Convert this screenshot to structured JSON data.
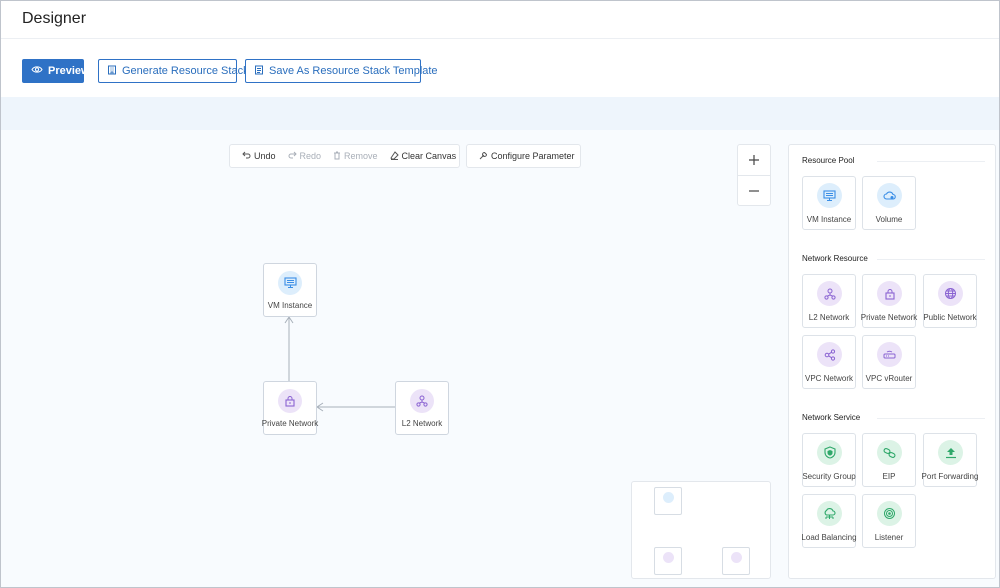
{
  "header": {
    "title": "Designer"
  },
  "actions": {
    "preview": "Preview",
    "generate": "Generate Resource Stack",
    "save_template": "Save As Resource Stack Template"
  },
  "toolbar": {
    "undo": "Undo",
    "redo": "Redo",
    "remove": "Remove",
    "clear_canvas": "Clear Canvas",
    "configure_parameter": "Configure Parameter"
  },
  "zoom": {
    "zoom_in": "+",
    "zoom_out": "−"
  },
  "canvas_nodes": [
    {
      "label": "VM Instance",
      "icon": "vm-instance-icon",
      "color": "blue"
    },
    {
      "label": "Private Network",
      "icon": "private-network-icon",
      "color": "purple"
    },
    {
      "label": "L2 Network",
      "icon": "l2-network-icon",
      "color": "purple"
    }
  ],
  "panel": {
    "sections": [
      {
        "title": "Resource Pool",
        "items": [
          {
            "label": "VM Instance",
            "icon": "vm-instance-icon",
            "color": "blue"
          },
          {
            "label": "Volume",
            "icon": "volume-icon",
            "color": "blue"
          }
        ]
      },
      {
        "title": "Network Resource",
        "items": [
          {
            "label": "L2 Network",
            "icon": "l2-network-icon",
            "color": "purple"
          },
          {
            "label": "Private Network",
            "icon": "private-network-icon",
            "color": "purple"
          },
          {
            "label": "Public Network",
            "icon": "public-network-icon",
            "color": "purple"
          },
          {
            "label": "VPC Network",
            "icon": "vpc-network-icon",
            "color": "purple"
          },
          {
            "label": "VPC vRouter",
            "icon": "vpc-vrouter-icon",
            "color": "purple"
          }
        ]
      },
      {
        "title": "Network Service",
        "items": [
          {
            "label": "Security Group",
            "icon": "security-group-icon",
            "color": "green"
          },
          {
            "label": "EIP",
            "icon": "eip-icon",
            "color": "green"
          },
          {
            "label": "Port Forwarding",
            "icon": "port-forwarding-icon",
            "color": "green"
          },
          {
            "label": "Load Balancing",
            "icon": "load-balancing-icon",
            "color": "green"
          },
          {
            "label": "Listener",
            "icon": "listener-icon",
            "color": "green"
          }
        ]
      }
    ]
  },
  "colors": {
    "primary": "#2f72c6",
    "blue_icon": "#3a8ee6",
    "purple_icon": "#8a63d2",
    "green_icon": "#2fa86a"
  }
}
